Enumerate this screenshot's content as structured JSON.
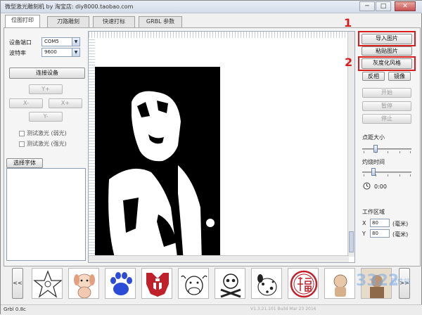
{
  "window": {
    "title": "微型激光雕刻机 by 淘宝店: diy8000.taobao.com",
    "min": "─",
    "max": "□",
    "close": "✕"
  },
  "tabs": [
    {
      "label": "位图打印"
    },
    {
      "label": "刀路雕刻"
    },
    {
      "label": "快速打标"
    },
    {
      "label": "GRBL 参数"
    }
  ],
  "left": {
    "port_label": "设备端口",
    "port_value": "COM5",
    "baud_label": "波特率",
    "baud_value": "9600",
    "connect_btn": "连接设备",
    "yplus": "Y+",
    "xminus": "X-",
    "xplus": "X+",
    "yminus": "Y-",
    "test_weak": "测试激光 (弱光)",
    "test_strong": "测试激光 (强光)",
    "choose_font": "选择字体"
  },
  "right": {
    "import_image": "导入图片",
    "paste_image": "粘贴图片",
    "gray_style": "灰度化风格",
    "invert": "反相",
    "mirror": "镜像",
    "start": "开始",
    "pause": "暂停",
    "stop": "停止",
    "dot_size_label": "点距大小",
    "dot_size_level": 0.25,
    "burn_time_label": "灼烧时间",
    "burn_time_level": 0.2,
    "timer": "0:00",
    "work_area_label": "工作区域",
    "x_label": "X",
    "x_value": "80",
    "y_label": "Y",
    "y_value": "80",
    "unit": "(毫米)"
  },
  "annotations": {
    "one": "1",
    "two": "2",
    "color": "#d81c1c"
  },
  "strip": {
    "prev": "<<",
    "next": ">>",
    "thumbnails": [
      "star-outline-icon",
      "cartoon-dog-icon",
      "paw-print-icon",
      "autobot-logo-icon",
      "cow-icon",
      "skull-crossbones-icon",
      "dalmatian-icon",
      "fu-seal-icon",
      "toy-character-icon",
      "photo-thumbnail"
    ]
  },
  "status": {
    "left": "Grbl 0.8c",
    "right": "V1.3.21.101 Build Mar 23 2016"
  },
  "watermark": {
    "main": "3322",
    "sub": "软件站"
  },
  "colors": {
    "paw": "#2c4bd6",
    "autobot": "#c0202a",
    "seal": "#c0202a"
  }
}
